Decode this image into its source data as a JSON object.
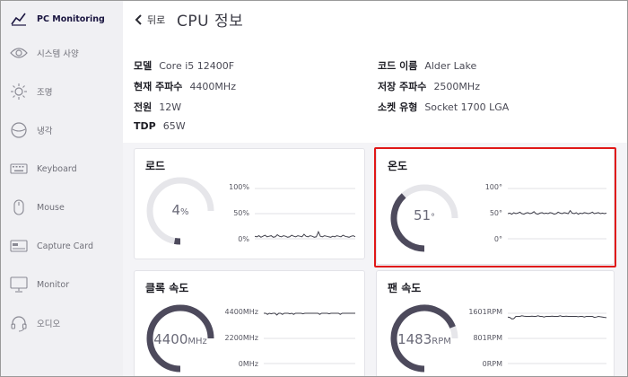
{
  "sidebar": {
    "items": [
      {
        "label": "PC Monitoring",
        "icon": "chart-line-icon",
        "active": true
      },
      {
        "label": "시스템 사양",
        "icon": "eye-icon",
        "active": false
      },
      {
        "label": "조명",
        "icon": "sun-icon",
        "active": false
      },
      {
        "label": "냉각",
        "icon": "fan-icon",
        "active": false
      },
      {
        "label": "Keyboard",
        "icon": "keyboard-icon",
        "active": false
      },
      {
        "label": "Mouse",
        "icon": "mouse-icon",
        "active": false
      },
      {
        "label": "Capture Card",
        "icon": "capture-card-icon",
        "active": false
      },
      {
        "label": "Monitor",
        "icon": "monitor-icon",
        "active": false
      },
      {
        "label": "오디오",
        "icon": "headset-icon",
        "active": false
      }
    ]
  },
  "header": {
    "back_label": "뒤로",
    "title": "CPU 정보"
  },
  "specs": {
    "model": {
      "label": "모델",
      "value": "Core i5 12400F"
    },
    "freq": {
      "label": "현재 주파수",
      "value": "4400MHz"
    },
    "power": {
      "label": "전원",
      "value": "12W"
    },
    "tdp": {
      "label": "TDP",
      "value": "65W"
    },
    "codename": {
      "label": "코드 이름",
      "value": "Alder Lake"
    },
    "stock_freq": {
      "label": "저장 주파수",
      "value": "2500MHz"
    },
    "socket": {
      "label": "소켓 유형",
      "value": "Socket 1700 LGA"
    }
  },
  "cards": {
    "load": {
      "title": "로드",
      "value": "4",
      "unit": "%",
      "fraction": 0.04,
      "axis": [
        "100%",
        "50%",
        "0%"
      ],
      "ymin": 0,
      "ymax": 100,
      "history": [
        5,
        4,
        6,
        3,
        5,
        7,
        4,
        5,
        6,
        3,
        4,
        8,
        5,
        4,
        6,
        5,
        3,
        4,
        7,
        5,
        4,
        6,
        5,
        4,
        9,
        5,
        4,
        6,
        5,
        3,
        4,
        14,
        5,
        4,
        6,
        5,
        4,
        3,
        5,
        4,
        6,
        5,
        4,
        7,
        5,
        4,
        3,
        5,
        6,
        4
      ]
    },
    "temp": {
      "title": "온도",
      "value": "51",
      "unit": "°",
      "fraction": 0.51,
      "axis": [
        "100°",
        "50°",
        "0°"
      ],
      "ymin": 0,
      "ymax": 100,
      "history": [
        50,
        51,
        49,
        52,
        50,
        51,
        53,
        50,
        49,
        51,
        52,
        50,
        51,
        54,
        50,
        49,
        51,
        52,
        50,
        51,
        50,
        52,
        51,
        49,
        50,
        53,
        51,
        50,
        52,
        51,
        50,
        56,
        51,
        50,
        52,
        49,
        51,
        50,
        52,
        51,
        50,
        51,
        53,
        50,
        51,
        52,
        50,
        51,
        50,
        51
      ]
    },
    "clock": {
      "title": "클록 속도",
      "value": "4400",
      "unit": "MHz",
      "fraction": 1.0,
      "axis": [
        "4400MHz",
        "2200MHz",
        "0MHz"
      ],
      "ymin": 0,
      "ymax": 4400,
      "history": [
        4400,
        4400,
        4300,
        4400,
        4350,
        4400,
        4400,
        4250,
        4400,
        4400,
        4300,
        4400,
        4400,
        4400,
        4350,
        4400,
        4300,
        4400,
        4400,
        4400,
        4400,
        4350,
        4400,
        4400,
        4400,
        4400,
        4400,
        4400,
        4400,
        4400,
        4300,
        4400,
        4400,
        4400,
        4400,
        4350,
        4400,
        4400,
        4400,
        4400,
        4400,
        4300,
        4400,
        4400,
        4400,
        4400,
        4400,
        4400,
        4400,
        4400
      ]
    },
    "fan": {
      "title": "팬 속도",
      "value": "1483",
      "unit": "RPM",
      "fraction": 0.92,
      "axis": [
        "1601RPM",
        "801RPM",
        "0RPM"
      ],
      "ymin": 0,
      "ymax": 1601,
      "history": [
        1480,
        1470,
        1420,
        1430,
        1500,
        1500,
        1500,
        1520,
        1510,
        1500,
        1500,
        1500,
        1510,
        1500,
        1500,
        1520,
        1500,
        1500,
        1480,
        1500,
        1500,
        1500,
        1510,
        1500,
        1500,
        1500,
        1520,
        1500,
        1500,
        1510,
        1500,
        1500,
        1500,
        1500,
        1500,
        1490,
        1500,
        1500,
        1480,
        1500,
        1500,
        1500,
        1500,
        1470,
        1480,
        1500,
        1490,
        1480,
        1470,
        1460
      ]
    }
  },
  "colors": {
    "gauge_track": "#e6e6ea",
    "gauge_fill": "#4d4a5c",
    "chart_line": "#3f3f4a",
    "grid_line": "#e2e2e6",
    "highlight": "#e01818"
  }
}
